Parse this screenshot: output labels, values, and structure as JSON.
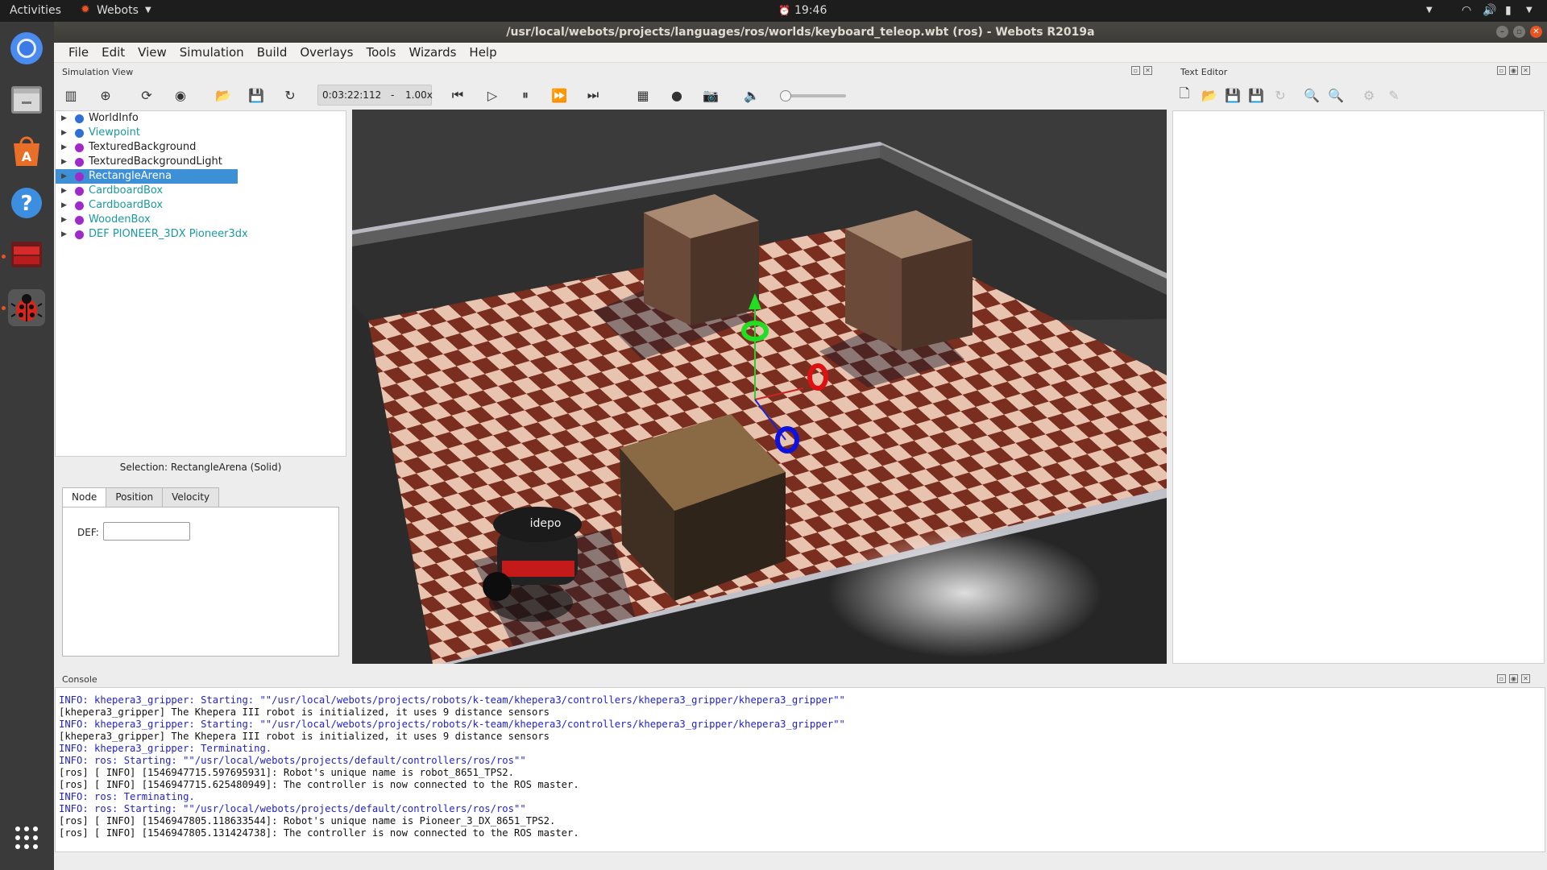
{
  "topbar": {
    "activities": "Activities",
    "app_name": "Webots",
    "clock": "19:46"
  },
  "window": {
    "title": "/usr/local/webots/projects/languages/ros/worlds/keyboard_teleop.wbt (ros) - Webots R2019a"
  },
  "menu": [
    "File",
    "Edit",
    "View",
    "Simulation",
    "Build",
    "Overlays",
    "Tools",
    "Wizards",
    "Help"
  ],
  "simulation_view": {
    "title": "Simulation View",
    "time": "0:03:22:112",
    "speed_sep": "-",
    "speed": "1.00x",
    "sound_volume": 0
  },
  "text_editor": {
    "title": "Text Editor"
  },
  "scene_tree": {
    "items": [
      {
        "label": "WorldInfo",
        "color": "#2f6fd8",
        "link": false,
        "selected": false
      },
      {
        "label": "Viewpoint",
        "color": "#2f6fd8",
        "link": true,
        "selected": false
      },
      {
        "label": "TexturedBackground",
        "color": "#a02ac8",
        "link": false,
        "selected": false
      },
      {
        "label": "TexturedBackgroundLight",
        "color": "#a02ac8",
        "link": false,
        "selected": false
      },
      {
        "label": "RectangleArena",
        "color": "#a02ac8",
        "link": false,
        "selected": true
      },
      {
        "label": "CardboardBox",
        "color": "#a02ac8",
        "link": true,
        "selected": false
      },
      {
        "label": "CardboardBox",
        "color": "#a02ac8",
        "link": true,
        "selected": false
      },
      {
        "label": "WoodenBox",
        "color": "#a02ac8",
        "link": true,
        "selected": false
      },
      {
        "label": "DEF PIONEER_3DX Pioneer3dx",
        "color": "#a02ac8",
        "link": true,
        "selected": false
      }
    ]
  },
  "field_editor": {
    "selection": "Selection: RectangleArena (Solid)",
    "tabs": [
      "Node",
      "Position",
      "Velocity"
    ],
    "active_tab": "Node",
    "def_label": "DEF:",
    "def_value": ""
  },
  "console": {
    "title": "Console",
    "lines": [
      {
        "type": "info",
        "text": "INFO: khepera3_gripper: Starting: \"\"/usr/local/webots/projects/robots/k-team/khepera3/controllers/khepera3_gripper/khepera3_gripper\"\""
      },
      {
        "type": "plain",
        "text": "[khepera3_gripper] The Khepera III robot is initialized, it uses 9 distance sensors"
      },
      {
        "type": "info",
        "text": "INFO: khepera3_gripper: Starting: \"\"/usr/local/webots/projects/robots/k-team/khepera3/controllers/khepera3_gripper/khepera3_gripper\"\""
      },
      {
        "type": "plain",
        "text": "[khepera3_gripper] The Khepera III robot is initialized, it uses 9 distance sensors"
      },
      {
        "type": "info",
        "text": "INFO: khepera3_gripper: Terminating."
      },
      {
        "type": "info",
        "text": "INFO: ros: Starting: \"\"/usr/local/webots/projects/default/controllers/ros/ros\"\""
      },
      {
        "type": "plain",
        "text": "[ros] [ INFO] [1546947715.597695931]: Robot's unique name is robot_8651_TPS2."
      },
      {
        "type": "plain",
        "text": "[ros] [ INFO] [1546947715.625480949]: The controller is now connected to the ROS master."
      },
      {
        "type": "info",
        "text": "INFO: ros: Terminating."
      },
      {
        "type": "info",
        "text": "INFO: ros: Starting: \"\"/usr/local/webots/projects/default/controllers/ros/ros\"\""
      },
      {
        "type": "plain",
        "text": "[ros] [ INFO] [1546947805.118633544]: Robot's unique name is Pioneer_3_DX_8651_TPS2."
      },
      {
        "type": "plain",
        "text": "[ros] [ INFO] [1546947805.131424738]: The controller is now connected to the ROS master."
      }
    ]
  },
  "viewport": {
    "robot_brand": "idepo",
    "robot_brand_small": "idepo"
  }
}
